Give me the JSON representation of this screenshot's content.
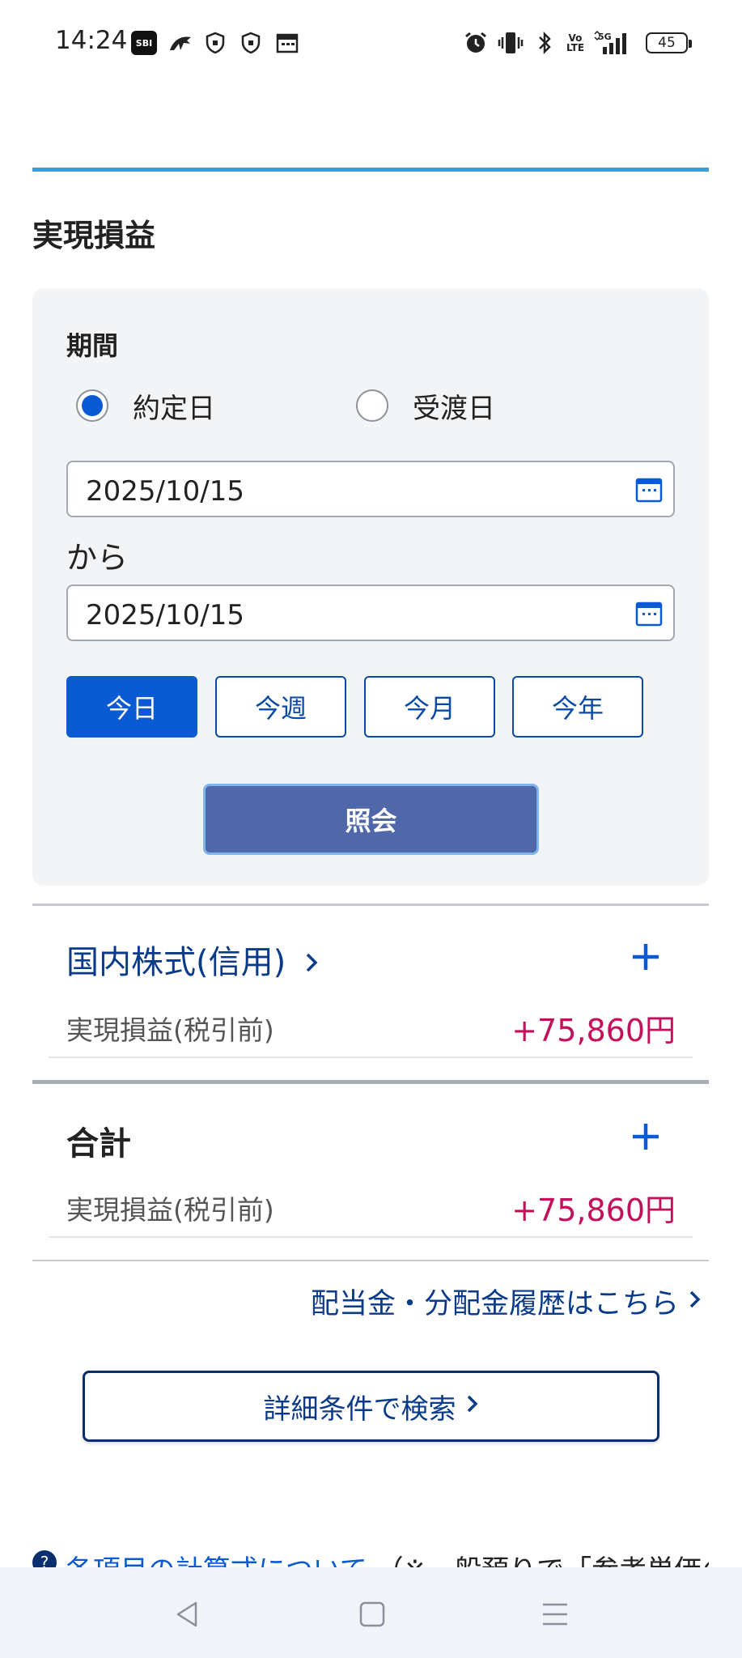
{
  "status_bar": {
    "time": "14:24",
    "battery": "45",
    "sbi_badge": "SBI",
    "left_icons": [
      "sbi-app-icon",
      "app-icon",
      "shield-icon",
      "shield-icon",
      "calendar-notification-icon"
    ],
    "right_icons": [
      "alarm-icon",
      "vibrate-icon",
      "bluetooth-icon",
      "volte-icon",
      "5g-signal-icon",
      "battery-icon"
    ]
  },
  "page": {
    "title": "実現損益"
  },
  "filter": {
    "period_label": "期間",
    "radio_options": [
      {
        "label": "約定日",
        "selected": true
      },
      {
        "label": "受渡日",
        "selected": false
      }
    ],
    "date_from": "2025/10/15",
    "separator": "から",
    "date_to": "2025/10/15",
    "quick_buttons": [
      {
        "label": "今日",
        "active": true
      },
      {
        "label": "今週",
        "active": false
      },
      {
        "label": "今月",
        "active": false
      },
      {
        "label": "今年",
        "active": false
      }
    ],
    "submit_label": "照会"
  },
  "sections": [
    {
      "title": "国内株式(信用)",
      "row_label": "実現損益(税引前)",
      "row_value": "+75,860円"
    },
    {
      "title": "合計",
      "row_label": "実現損益(税引前)",
      "row_value": "+75,860円"
    }
  ],
  "links": {
    "dividend_history": "配当金・分配金履歴はこちら",
    "detail_search": "詳細条件で検索"
  },
  "help": {
    "link_text": "各項目の計算式について",
    "note": "（※一般預りで「参考単価の"
  },
  "colors": {
    "accent": "#0a5bd3",
    "topline": "#3b9cdb",
    "positive_value": "#c4105b",
    "submit_button": "#5067a9"
  }
}
